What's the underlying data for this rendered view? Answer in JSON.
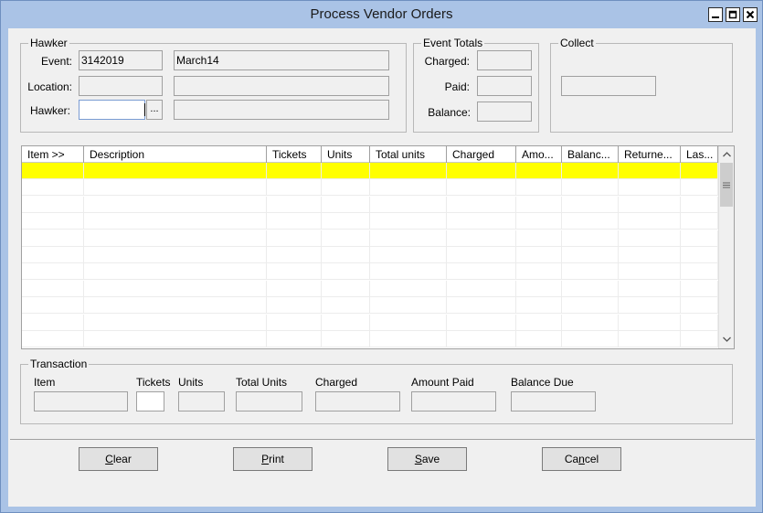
{
  "window": {
    "title": "Process Vendor Orders"
  },
  "hawker": {
    "group_title": "Hawker",
    "event_label": "Event:",
    "event_code": "3142019",
    "event_name": "March14",
    "location_label": "Location:",
    "location_code": "",
    "location_name": "",
    "hawker_label": "Hawker:",
    "hawker_value": "",
    "hawker_name": "",
    "ellipsis_label": "..."
  },
  "event_totals": {
    "group_title": "Event Totals",
    "charged_label": "Charged:",
    "paid_label": "Paid:",
    "balance_label": "Balance:",
    "charged": "",
    "paid": "",
    "balance": ""
  },
  "collect": {
    "group_title": "Collect",
    "value": ""
  },
  "grid": {
    "columns": [
      {
        "label": "Item >>"
      },
      {
        "label": "Description"
      },
      {
        "label": "Tickets"
      },
      {
        "label": "Units"
      },
      {
        "label": "Total units"
      },
      {
        "label": "Charged"
      },
      {
        "label": "Amo..."
      },
      {
        "label": "Balanc..."
      },
      {
        "label": "Returne..."
      },
      {
        "label": "Las..."
      }
    ],
    "selected_row_color": "#ffff00"
  },
  "transaction": {
    "group_title": "Transaction",
    "item_label": "Item",
    "tickets_label": "Tickets",
    "units_label": "Units",
    "total_units_label": "Total Units",
    "charged_label": "Charged",
    "amount_paid_label": "Amount Paid",
    "balance_due_label": "Balance Due"
  },
  "buttons": {
    "clear_rest": "lear",
    "clear_mnemonic": "C",
    "print_rest": "rint",
    "print_mnemonic": "P",
    "save_rest": "ave",
    "save_mnemonic": "S",
    "cancel_pre": "Ca",
    "cancel_mnemonic": "n",
    "cancel_post": "cel"
  }
}
